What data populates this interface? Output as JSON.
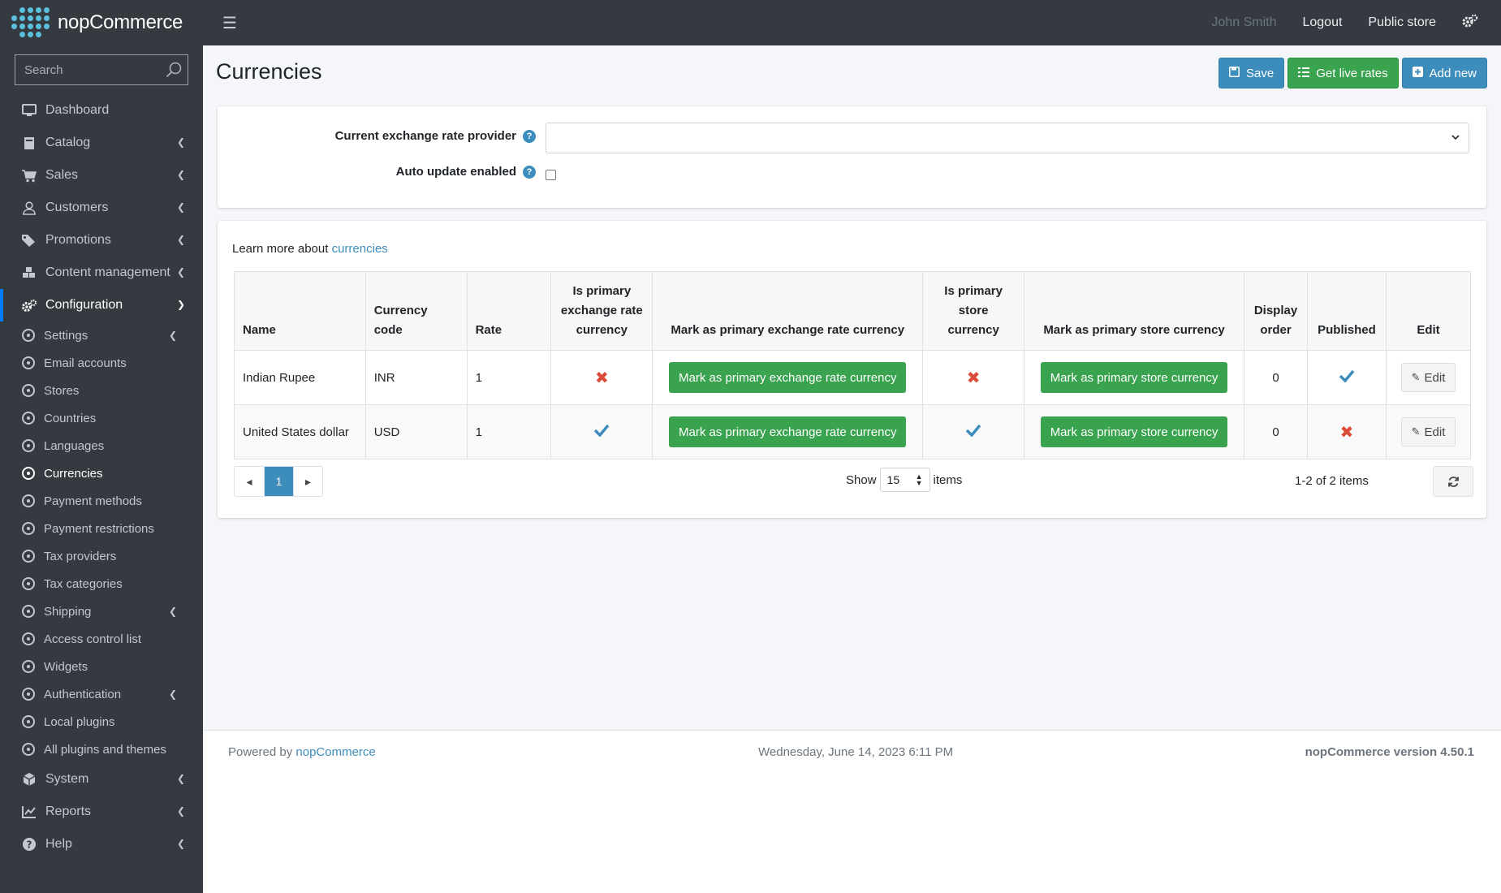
{
  "brand": {
    "name": "nopCommerce"
  },
  "header": {
    "user_name": "John Smith",
    "logout": "Logout",
    "public_store": "Public store"
  },
  "sidebar": {
    "search_placeholder": "Search",
    "items": [
      {
        "label": "Dashboard",
        "icon": "monitor-icon"
      },
      {
        "label": "Catalog",
        "icon": "book-icon"
      },
      {
        "label": "Sales",
        "icon": "cart-icon"
      },
      {
        "label": "Customers",
        "icon": "user-icon"
      },
      {
        "label": "Promotions",
        "icon": "tags-icon"
      },
      {
        "label": "Content management",
        "icon": "cubes-icon"
      },
      {
        "label": "Configuration",
        "icon": "gears-icon"
      }
    ],
    "config_sub": [
      "Settings",
      "Email accounts",
      "Stores",
      "Countries",
      "Languages",
      "Currencies",
      "Payment methods",
      "Payment restrictions",
      "Tax providers",
      "Tax categories",
      "Shipping",
      "Access control list",
      "Widgets",
      "Authentication",
      "Local plugins",
      "All plugins and themes"
    ],
    "bottom_items": [
      {
        "label": "System",
        "icon": "cube-icon"
      },
      {
        "label": "Reports",
        "icon": "chart-icon"
      },
      {
        "label": "Help",
        "icon": "question-icon"
      }
    ]
  },
  "page": {
    "title": "Currencies",
    "save": "Save",
    "get_live_rates": "Get live rates",
    "add_new": "Add new"
  },
  "settings_form": {
    "provider_label": "Current exchange rate provider",
    "provider_value": "",
    "auto_update_label": "Auto update enabled",
    "auto_update_checked": false
  },
  "learn_more": {
    "prefix": "Learn more about",
    "link": "currencies"
  },
  "grid": {
    "columns": {
      "name": "Name",
      "code": "Currency code",
      "rate": "Rate",
      "is_primary_exchange": "Is primary exchange rate currency",
      "mark_exchange": "Mark as primary exchange rate currency",
      "is_primary_store": "Is primary store currency",
      "mark_store": "Mark as primary store currency",
      "display_order": "Display order",
      "published": "Published",
      "edit": "Edit"
    },
    "rows": [
      {
        "name": "Indian Rupee",
        "code": "INR",
        "rate": "1",
        "is_primary_exchange": false,
        "is_primary_store": false,
        "display_order": "0",
        "published": true
      },
      {
        "name": "United States dollar",
        "code": "USD",
        "rate": "1",
        "is_primary_exchange": true,
        "is_primary_store": true,
        "display_order": "0",
        "published": false
      }
    ],
    "mark_exchange_label": "Mark as primary exchange rate currency",
    "mark_store_label": "Mark as primary store currency",
    "edit_label": "Edit"
  },
  "pager": {
    "current_page": "1",
    "show_label": "Show",
    "page_size": "15",
    "items_label": "items",
    "summary": "1-2 of 2 items"
  },
  "footer": {
    "powered_by": "Powered by",
    "powered_link": "nopCommerce",
    "datetime": "Wednesday, June 14, 2023 6:11 PM",
    "version": "nopCommerce version 4.50.1"
  },
  "colors": {
    "header_bg": "#343a40",
    "accent_blue": "#3c8dbc",
    "accent_green": "#3aa34f",
    "danger_red": "#dd4b39"
  }
}
